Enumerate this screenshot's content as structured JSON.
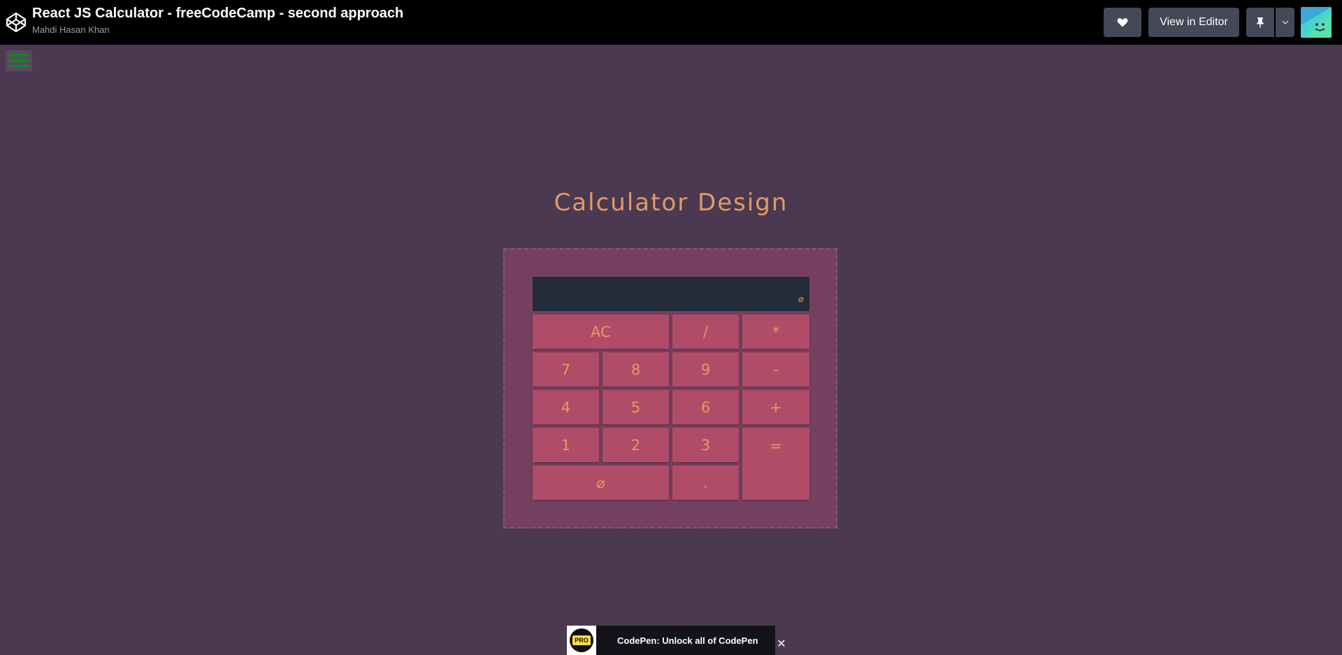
{
  "header": {
    "title": "React JS Calculator - freeCodeCamp - second approach",
    "author": "Mahdi Hasan Khan",
    "heart_icon": "heart-icon",
    "view_editor_label": "View in Editor",
    "pin_icon": "pin-icon",
    "caret_icon": "chevron-down-icon"
  },
  "page": {
    "heading": "Calculator Design"
  },
  "calculator": {
    "display_value": "⌀",
    "keys": {
      "clear": "AC",
      "divide": "/",
      "multiply": "*",
      "seven": "7",
      "eight": "8",
      "nine": "9",
      "subtract": "-",
      "four": "4",
      "five": "5",
      "six": "6",
      "add": "+",
      "one": "1",
      "two": "2",
      "three": "3",
      "equals": "=",
      "zero": "⌀",
      "decimal": "."
    }
  },
  "promo": {
    "badge": "PRO",
    "label": "CodePen: Unlock all of CodePen",
    "close": "✕"
  },
  "colors": {
    "background": "#4b3951",
    "frame": "#74405f",
    "key": "#b04c68",
    "accent": "#e39a63",
    "display": "#232b38"
  }
}
